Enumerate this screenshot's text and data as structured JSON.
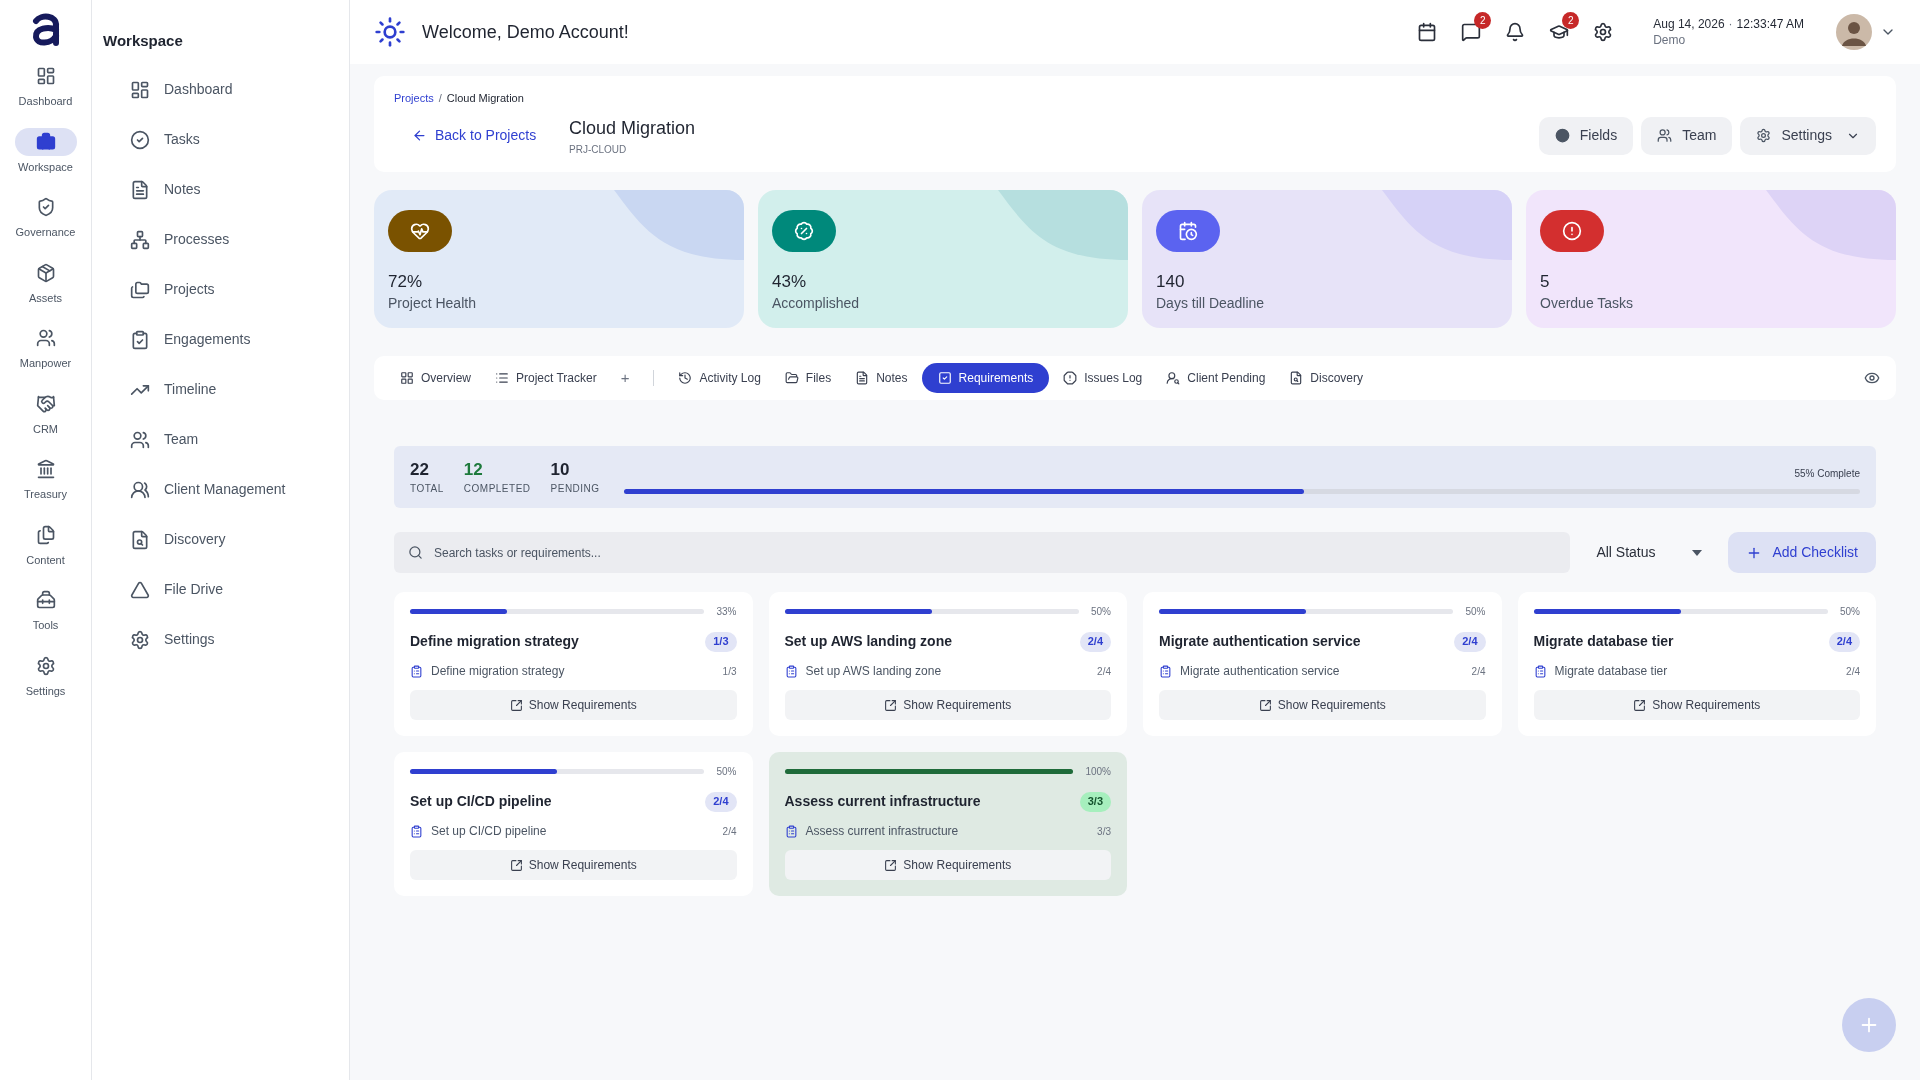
{
  "rail": {
    "items": [
      {
        "label": "Dashboard",
        "kind": "dashboard",
        "selected": false
      },
      {
        "label": "Workspace",
        "kind": "workspace",
        "selected": true
      },
      {
        "label": "Governance",
        "kind": "governance",
        "selected": false
      },
      {
        "label": "Assets",
        "kind": "assets",
        "selected": false
      },
      {
        "label": "Manpower",
        "kind": "manpower",
        "selected": false
      },
      {
        "label": "CRM",
        "kind": "crm",
        "selected": false
      },
      {
        "label": "Treasury",
        "kind": "treasury",
        "selected": false
      },
      {
        "label": "Content",
        "kind": "content",
        "selected": false
      },
      {
        "label": "Tools",
        "kind": "tools",
        "selected": false
      },
      {
        "label": "Settings",
        "kind": "settings",
        "selected": false
      }
    ]
  },
  "sidebar": {
    "title": "Workspace",
    "items": [
      {
        "label": "Dashboard",
        "kind": "dashboard"
      },
      {
        "label": "Tasks",
        "kind": "tasks"
      },
      {
        "label": "Notes",
        "kind": "notes"
      },
      {
        "label": "Processes",
        "kind": "processes"
      },
      {
        "label": "Projects",
        "kind": "projects"
      },
      {
        "label": "Engagements",
        "kind": "engagements"
      },
      {
        "label": "Timeline",
        "kind": "timeline"
      },
      {
        "label": "Team",
        "kind": "team"
      },
      {
        "label": "Client Management",
        "kind": "clients"
      },
      {
        "label": "Discovery",
        "kind": "discovery"
      },
      {
        "label": "File Drive",
        "kind": "drive"
      },
      {
        "label": "Settings",
        "kind": "settings"
      }
    ]
  },
  "header": {
    "welcome": "Welcome, Demo Account!",
    "icons": [
      {
        "kind": "calendar"
      },
      {
        "kind": "messages",
        "badge": "2"
      },
      {
        "kind": "bell"
      },
      {
        "kind": "learning",
        "badge": "2"
      },
      {
        "kind": "settings"
      }
    ],
    "date": "Aug 14, 2026",
    "separator": "·",
    "time": "12:33:47 AM",
    "user": "Demo"
  },
  "project": {
    "breadcrumb": [
      "Projects",
      "Cloud Migration"
    ],
    "breadcrumb_separator": "/",
    "back": "Back to Projects",
    "title": "Cloud Migration",
    "code": "PRJ-CLOUD",
    "actions": [
      {
        "label": "Fields",
        "kind": "fields"
      },
      {
        "label": "Team",
        "kind": "team"
      },
      {
        "label": "Settings",
        "kind": "settings"
      }
    ]
  },
  "stats": [
    {
      "value": "72%",
      "label": "Project Health",
      "kind": "health",
      "color": "#7a5200"
    },
    {
      "value": "43%",
      "label": "Accomplished",
      "kind": "accomplished",
      "color": "#00897b"
    },
    {
      "value": "140",
      "label": "Days till Deadline",
      "kind": "deadline",
      "color": "#5b63f0"
    },
    {
      "value": "5",
      "label": "Overdue Tasks",
      "kind": "overdue",
      "color": "#d32f2f"
    }
  ],
  "tabs": [
    {
      "label": "Overview",
      "kind": "overview",
      "selected": false
    },
    {
      "label": "Project Tracker",
      "kind": "tracker",
      "selected": false
    },
    {
      "label": "+",
      "kind": "add",
      "selected": false
    },
    {
      "label": "Activity Log",
      "kind": "activity",
      "selected": false
    },
    {
      "label": "Files",
      "kind": "files",
      "selected": false
    },
    {
      "label": "Notes",
      "kind": "notes",
      "selected": false
    },
    {
      "label": "Requirements",
      "kind": "requirements",
      "selected": true
    },
    {
      "label": "Issues Log",
      "kind": "issues",
      "selected": false
    },
    {
      "label": "Client Pending",
      "kind": "pending",
      "selected": false
    },
    {
      "label": "Discovery",
      "kind": "discovery",
      "selected": false
    }
  ],
  "summary": {
    "counts": [
      {
        "value": "22",
        "label": "TOTAL",
        "kind": "total"
      },
      {
        "value": "12",
        "label": "COMPLETED",
        "kind": "completed"
      },
      {
        "value": "10",
        "label": "PENDING",
        "kind": "pending"
      }
    ],
    "complete_label": "55% Complete",
    "level": 0.55
  },
  "search": {
    "placeholder": "Search tasks or requirements..."
  },
  "status_filter": "All Status",
  "add_button": "Add Checklist",
  "checklists": [
    {
      "percent": "33%",
      "level": 0.33,
      "title": "Define migration strategy",
      "count": "1/3",
      "item": "Define migration strategy",
      "item_count": "1/3",
      "button": "Show Requirements",
      "complete": false
    },
    {
      "percent": "50%",
      "level": 0.5,
      "title": "Set up AWS landing zone",
      "count": "2/4",
      "item": "Set up AWS landing zone",
      "item_count": "2/4",
      "button": "Show Requirements",
      "complete": false
    },
    {
      "percent": "50%",
      "level": 0.5,
      "title": "Migrate authentication service",
      "count": "2/4",
      "item": "Migrate authentication service",
      "item_count": "2/4",
      "button": "Show Requirements",
      "complete": false
    },
    {
      "percent": "50%",
      "level": 0.5,
      "title": "Migrate database tier",
      "count": "2/4",
      "item": "Migrate database tier",
      "item_count": "2/4",
      "button": "Show Requirements",
      "complete": false
    },
    {
      "percent": "50%",
      "level": 0.5,
      "title": "Set up CI/CD pipeline",
      "count": "2/4",
      "item": "Set up CI/CD pipeline",
      "item_count": "2/4",
      "button": "Show Requirements",
      "complete": false
    },
    {
      "percent": "100%",
      "level": 1,
      "title": "Assess current infrastructure",
      "count": "3/3",
      "item": "Assess current infrastructure",
      "item_count": "3/3",
      "button": "Show Requirements",
      "complete": true
    }
  ]
}
